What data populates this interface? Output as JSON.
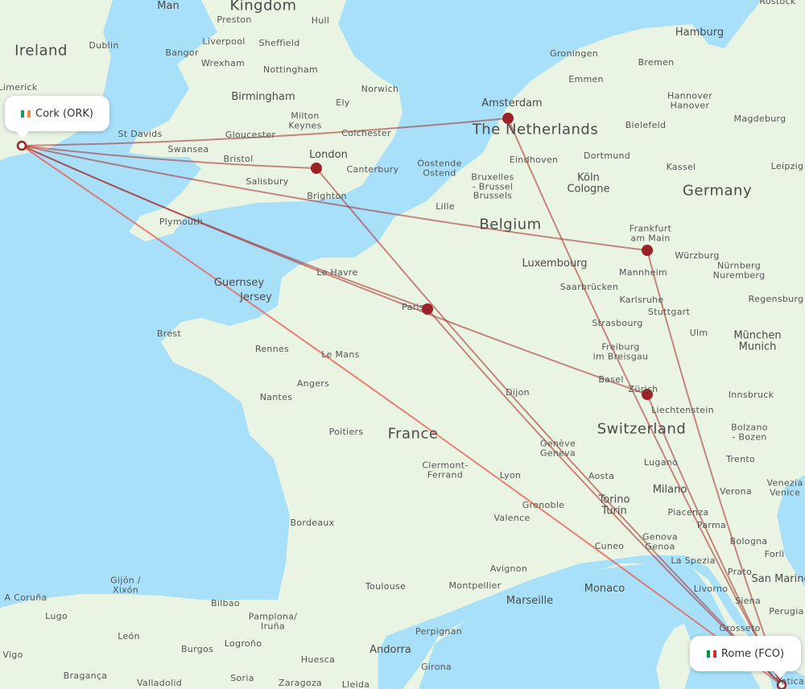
{
  "map": {
    "colors": {
      "water": "#a8e0fa",
      "land": "#eaf4e3",
      "route": "#a52a2a",
      "route_direct": "#e8605a",
      "hub_marker": "#9b2226",
      "endpoint_marker": "#9b2226"
    },
    "origin": {
      "city": "Cork",
      "code": "ORK",
      "label": "Cork (ORK)",
      "flag": [
        "#169b62",
        "#ffffff",
        "#ff883e"
      ]
    },
    "destination": {
      "city": "Rome",
      "code": "FCO",
      "label": "Rome (FCO)",
      "flag": [
        "#009246",
        "#ffffff",
        "#ce2b37"
      ]
    },
    "hubs": [
      "London",
      "Amsterdam",
      "Paris",
      "Frankfurt am Main",
      "Zürich"
    ],
    "routes": [
      {
        "from": "Cork",
        "via": "London",
        "to": "Rome"
      },
      {
        "from": "Cork",
        "via": "Amsterdam",
        "to": "Rome"
      },
      {
        "from": "Cork",
        "via": "Paris",
        "to": "Rome"
      },
      {
        "from": "Cork",
        "via": "Frankfurt am Main",
        "to": "Rome"
      },
      {
        "from": "Cork",
        "via": "Zürich",
        "to": "Rome"
      },
      {
        "from": "Cork",
        "via": "",
        "to": "Rome"
      }
    ],
    "country_labels": [
      "Ireland",
      "Kingdom",
      "The Netherlands",
      "Belgium",
      "Germany",
      "France",
      "Switzerland",
      "Luxembourg",
      "Liechtenstein",
      "Monaco",
      "Andorra",
      "San Marino",
      "Guernsey",
      "Jersey",
      "Man"
    ],
    "city_labels": [
      "Dublin",
      "Limerick",
      "Preston",
      "Hull",
      "Liverpool",
      "Sheffield",
      "Bangor",
      "Wrexham",
      "Nottingham",
      "Birmingham",
      "Norwich",
      "Ely",
      "Milton Keynes",
      "Colchester",
      "St Davids",
      "Gloucester",
      "Swansea",
      "Bristol",
      "London",
      "Canterbury",
      "Salisbury",
      "Brighton",
      "Plymouth",
      "Amsterdam",
      "Groningen",
      "Emmen",
      "Hamburg",
      "Bremen",
      "Hannover Hanover",
      "Magdeburg",
      "Bielefeld",
      "Dortmund",
      "Köln Cologne",
      "Kassel",
      "Leipzig",
      "Eindhoven",
      "Oostende Ostend",
      "Bruxelles - Brussel Brussels",
      "Lille",
      "Rostock",
      "Frankfurt am Main",
      "Würzburg",
      "Nürnberg Nuremberg",
      "Mannheim",
      "Saarbrücken",
      "Karlsruhe",
      "Stuttgart",
      "Regensburg",
      "Strasbourg",
      "Ulm",
      "München Munich",
      "Freiburg im Breisgau",
      "Basel",
      "Zürich",
      "Innsbruck",
      "Bolzano - Bozen",
      "Le Havre",
      "Paris",
      "Brest",
      "Rennes",
      "Le Mans",
      "Angers",
      "Nantes",
      "Poitiers",
      "Dijon",
      "Genève Geneva",
      "Clermont-Ferrand",
      "Lyon",
      "Lugano",
      "Trento",
      "Aosta",
      "Milano",
      "Verona",
      "Venezia Venice",
      "Torino Turin",
      "Piacenza",
      "Grenoble",
      "Parma",
      "Valence",
      "Bologna",
      "Forlì",
      "Cuneo",
      "Genova Genoa",
      "La Spezia",
      "Prato",
      "Avignon",
      "Montpellier",
      "Marseille",
      "Livorno",
      "Siena",
      "Perugia",
      "Grosseto",
      "Vatican",
      "Bordeaux",
      "Toulouse",
      "Perpignan",
      "Gijón / Xixón",
      "A Coruña",
      "Lugo",
      "León",
      "Bilbao",
      "Pamplona/ Iruña",
      "Logroño",
      "Burgos",
      "Huesca",
      "Girona",
      "Vigo",
      "Bragança",
      "Valladolid",
      "Soria",
      "Zaragoza",
      "Lleida"
    ]
  }
}
